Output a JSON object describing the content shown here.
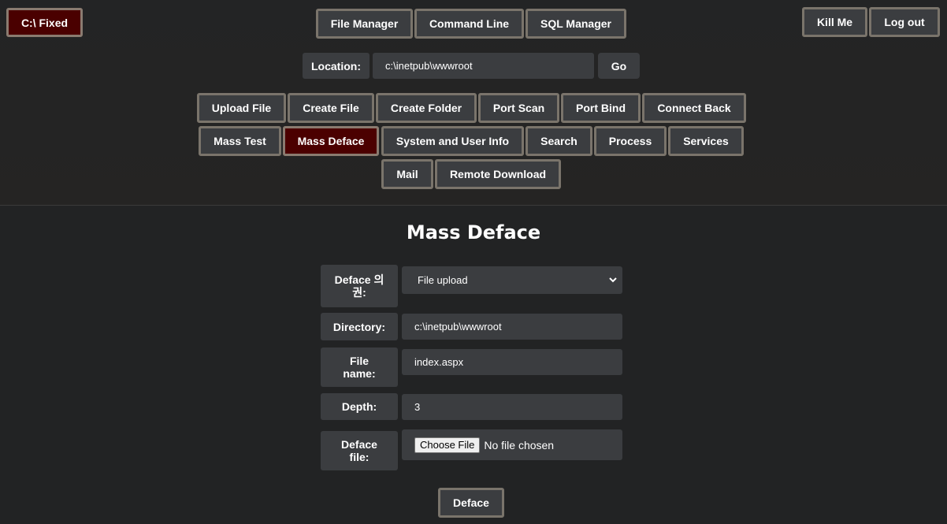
{
  "header": {
    "fixed_label": "C:\\ Fixed",
    "main_nav": [
      "File Manager",
      "Command Line",
      "SQL Manager"
    ],
    "kill_label": "Kill Me",
    "logout_label": "Log out"
  },
  "location": {
    "label": "Location:",
    "value": "c:\\inetpub\\wwwroot",
    "go_label": "Go"
  },
  "tools": {
    "row1": [
      "Upload File",
      "Create File",
      "Create Folder",
      "Port Scan",
      "Port Bind",
      "Connect Back"
    ],
    "row2": [
      "Mass Test",
      "Mass Deface",
      "System and User Info",
      "Search",
      "Process",
      "Services"
    ],
    "row3": [
      "Mail",
      "Remote Download"
    ],
    "active": "Mass Deface"
  },
  "form": {
    "title": "Mass Deface",
    "deface_type_label_line1": "Deface 의",
    "deface_type_label_line2": "권:",
    "deface_type_value": "File upload",
    "directory_label": "Directory:",
    "directory_value": "c:\\inetpub\\wwwroot",
    "file_name_label_line1": "File",
    "file_name_label_line2": "name:",
    "file_name_value": "index.aspx",
    "depth_label": "Depth:",
    "depth_value": "3",
    "deface_file_label_line1": "Deface",
    "deface_file_label_line2": "file:",
    "choose_file_label": "Choose File",
    "file_status": "No file chosen",
    "submit_label": "Deface"
  },
  "colors": {
    "background": "#222324",
    "button_bg": "#3b3d40",
    "button_border": "#7a746b",
    "active_bg": "#4b0000"
  }
}
